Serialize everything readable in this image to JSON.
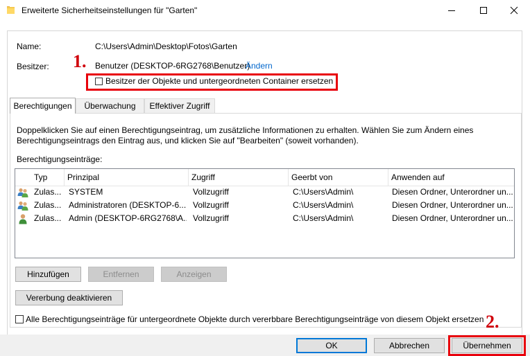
{
  "window": {
    "title": "Erweiterte Sicherheitseinstellungen für \"Garten\"",
    "controls": {
      "minimize": "—",
      "maximize": "☐",
      "close": "✕"
    }
  },
  "info": {
    "name_label": "Name:",
    "name_value": "C:\\Users\\Admin\\Desktop\\Fotos\\Garten",
    "owner_label": "Besitzer:",
    "owner_value": "Benutzer (DESKTOP-6RG2768\\Benutzer)",
    "change_link": "Ändern",
    "replace_owner_checkbox": "Besitzer der Objekte und untergeordneten Container ersetzen",
    "replace_owner_checked": false
  },
  "tabs": [
    {
      "label": "Berechtigungen",
      "active": true
    },
    {
      "label": "Überwachung",
      "active": false
    },
    {
      "label": "Effektiver Zugriff",
      "active": false
    }
  ],
  "permissions": {
    "description": "Doppelklicken Sie auf einen Berechtigungseintrag, um zusätzliche Informationen zu erhalten. Wählen Sie zum Ändern eines Berechtigungseintrags den Eintrag aus, und klicken Sie auf \"Bearbeiten\" (soweit vorhanden).",
    "entries_label": "Berechtigungseinträge:",
    "columns": [
      "Typ",
      "Prinzipal",
      "Zugriff",
      "Geerbt von",
      "Anwenden auf"
    ],
    "rows": [
      {
        "icon": "group-icon",
        "typ": "Zulas...",
        "prinzipal": "SYSTEM",
        "zugriff": "Vollzugriff",
        "geerbt": "C:\\Users\\Admin\\",
        "anwenden": "Diesen Ordner, Unterordner un..."
      },
      {
        "icon": "group-icon",
        "typ": "Zulas...",
        "prinzipal": "Administratoren (DESKTOP-6...",
        "zugriff": "Vollzugriff",
        "geerbt": "C:\\Users\\Admin\\",
        "anwenden": "Diesen Ordner, Unterordner un..."
      },
      {
        "icon": "user-icon",
        "typ": "Zulas...",
        "prinzipal": "Admin (DESKTOP-6RG2768\\A...",
        "zugriff": "Vollzugriff",
        "geerbt": "C:\\Users\\Admin\\",
        "anwenden": "Diesen Ordner, Unterordner un..."
      }
    ],
    "buttons": {
      "add": "Hinzufügen",
      "remove": "Entfernen",
      "view": "Anzeigen"
    },
    "disable_inheritance": "Vererbung deaktivieren",
    "replace_all_checkbox": "Alle Berechtigungseinträge für untergeordnete Objekte durch vererbbare Berechtigungseinträge von diesem Objekt ersetzen",
    "replace_all_checked": false
  },
  "footer": {
    "ok": "OK",
    "cancel": "Abbrechen",
    "apply": "Übernehmen"
  },
  "annotations": {
    "step1": "1.",
    "step2": "2.",
    "highlight_color": "#e8000b"
  },
  "colors": {
    "accent": "#0078d7",
    "link": "#0066cc"
  }
}
